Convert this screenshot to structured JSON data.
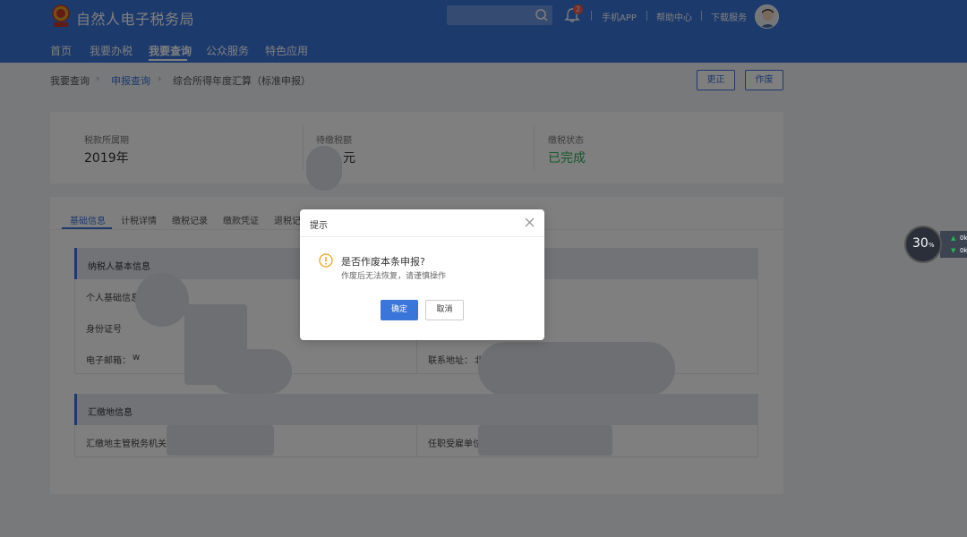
{
  "header": {
    "brand": "自然人电子税务局",
    "notification_count": "2",
    "links": [
      "手机APP",
      "帮助中心",
      "下载服务"
    ],
    "nav": [
      "首页",
      "我要办税",
      "我要查询",
      "公众服务",
      "特色应用"
    ],
    "active_nav": "我要查询"
  },
  "breadcrumb": {
    "items": [
      "我要查询",
      "申报查询",
      "综合所得年度汇算（标准申报）"
    ]
  },
  "actions": {
    "correct_label": "更正",
    "void_label": "作废"
  },
  "summary": {
    "period_label": "税款所属期",
    "period_value": "2019年",
    "tax_due_label": "待缴税额",
    "tax_due_unit": "元",
    "status_label": "缴税状态",
    "status_value": "已完成",
    "status_color": "#2db057"
  },
  "tabs": [
    "基础信息",
    "计税详情",
    "缴税记录",
    "缴款凭证",
    "退税记"
  ],
  "sections": {
    "basic_title": "纳税人基本信息",
    "basic_rows": [
      "个人基础信息",
      "身份证号",
      "电子邮箱：",
      "联系地址："
    ],
    "email_prefix": "w",
    "address_prefix": "北",
    "remit_title": "汇缴地信息",
    "remit_rows": [
      "汇缴地主管税务机关",
      "任职受雇单位"
    ]
  },
  "widget": {
    "percent": "30",
    "percent_unit": "%",
    "up": "0k",
    "down": "0k"
  },
  "modal": {
    "title": "提示",
    "message": "是否作废本条申报?",
    "sub_message": "作废后无法恢复，请谨慎操作",
    "confirm_label": "确定",
    "cancel_label": "取消",
    "accent_color": "#3a75d9",
    "warn_color": "#f0a020"
  }
}
